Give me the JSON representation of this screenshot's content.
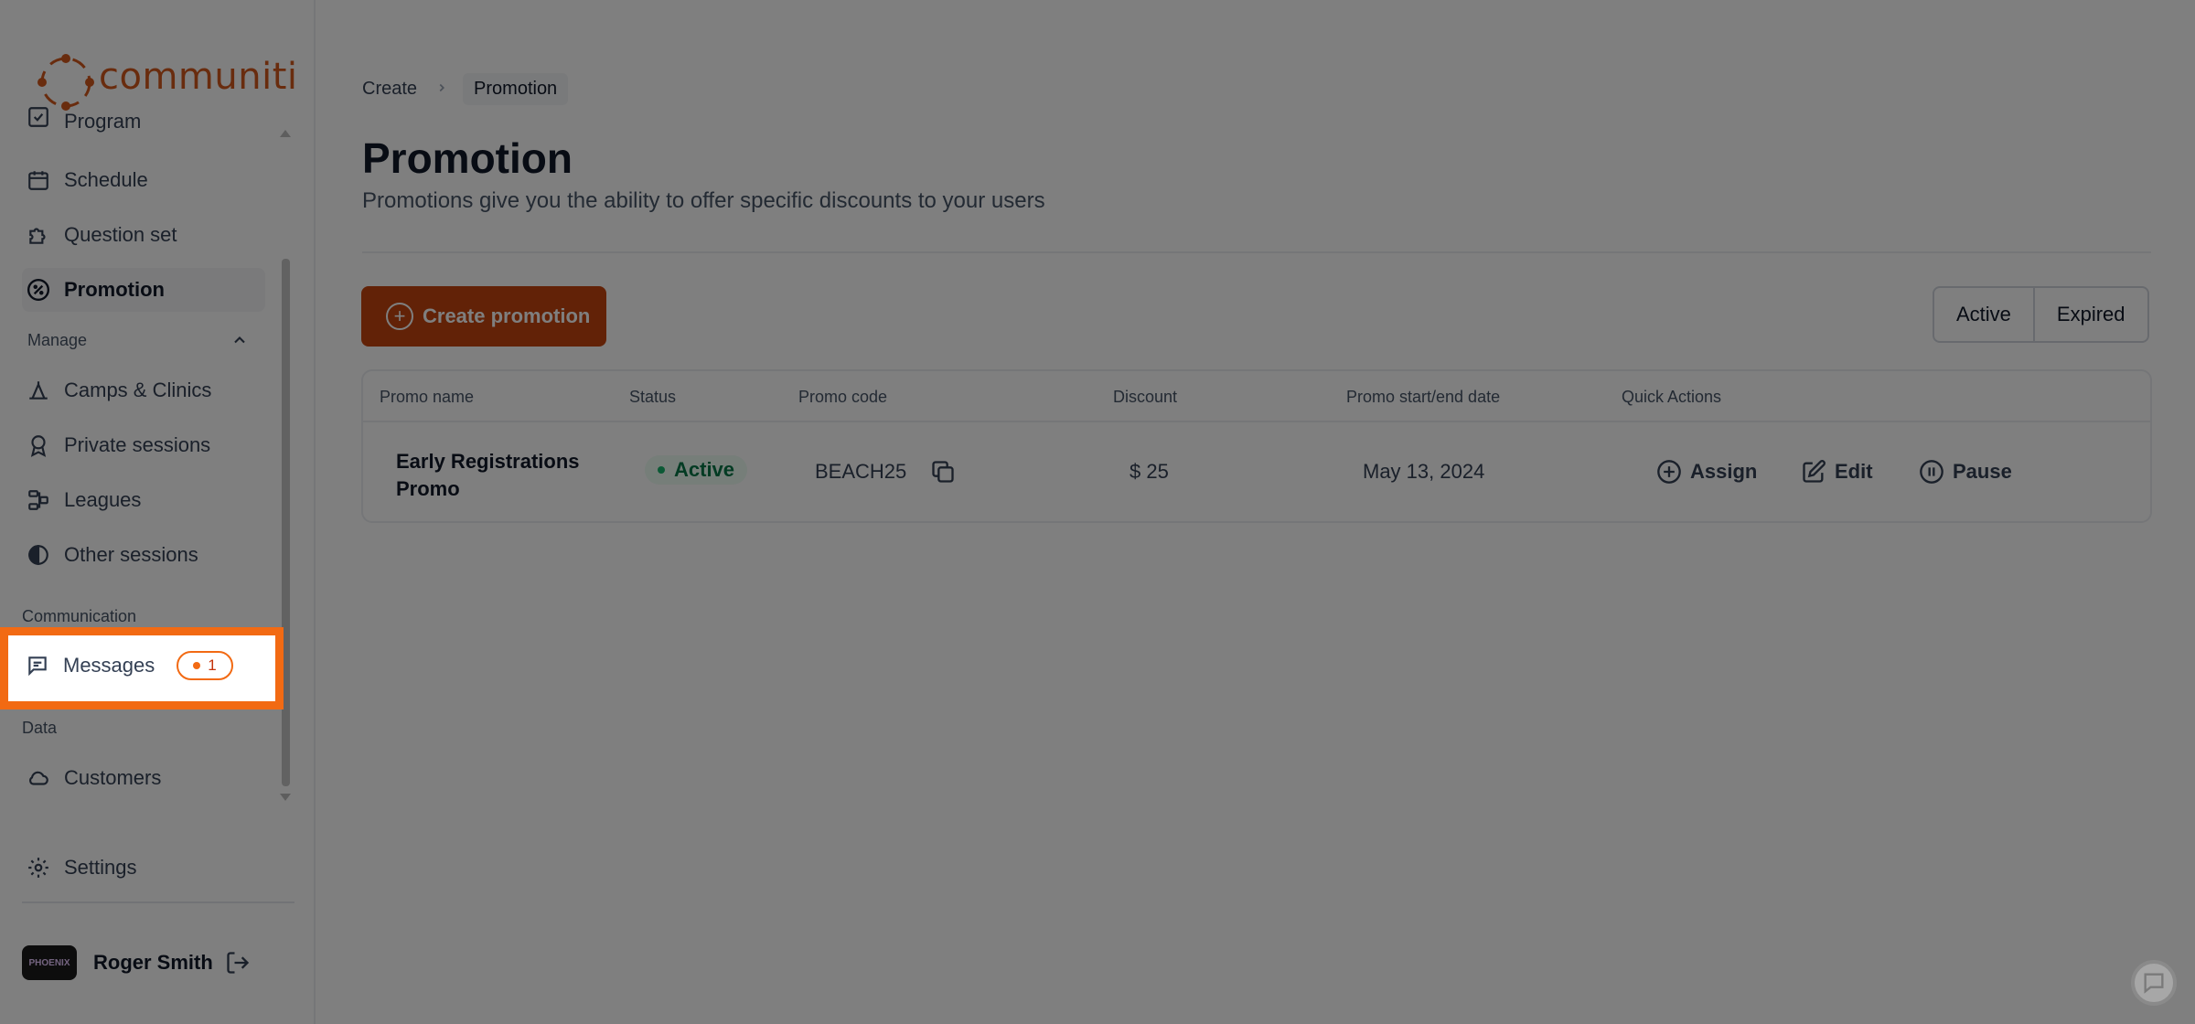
{
  "brand": {
    "name": "communiti",
    "accent": "#d3581d"
  },
  "sidebar": {
    "items": [
      {
        "label": "Program",
        "icon": "program-icon"
      },
      {
        "label": "Schedule",
        "icon": "calendar-icon"
      },
      {
        "label": "Question set",
        "icon": "puzzle-icon"
      },
      {
        "label": "Promotion",
        "icon": "percent-icon",
        "active": true
      }
    ],
    "manage": {
      "label": "Manage",
      "items": [
        {
          "label": "Camps & Clinics",
          "icon": "camp-icon"
        },
        {
          "label": "Private sessions",
          "icon": "award-icon"
        },
        {
          "label": "Leagues",
          "icon": "bracket-icon"
        },
        {
          "label": "Other sessions",
          "icon": "half-circle-icon"
        }
      ]
    },
    "communication": {
      "label": "Communication",
      "messages": {
        "label": "Messages",
        "count": "1"
      }
    },
    "data": {
      "label": "Data",
      "items": [
        {
          "label": "Customers",
          "icon": "cloud-icon"
        }
      ]
    },
    "settings": {
      "label": "Settings"
    },
    "user": {
      "name": "Roger Smith",
      "avatar_text": "PHOENIX"
    }
  },
  "breadcrumb": {
    "root": "Create",
    "current": "Promotion"
  },
  "page": {
    "title": "Promotion",
    "subtitle": "Promotions give you the ability to offer specific discounts to your users"
  },
  "toolbar": {
    "create_label": "Create promotion",
    "filter_active": "Active",
    "filter_expired": "Expired"
  },
  "table": {
    "headers": [
      "Promo name",
      "Status",
      "Promo code",
      "Discount",
      "Promo start/end date",
      "Quick Actions"
    ],
    "rows": [
      {
        "name_line1": "Early Registrations",
        "name_line2": "Promo",
        "status": "Active",
        "code": "BEACH25",
        "discount": "$ 25",
        "date": "May 13, 2024",
        "actions": {
          "assign": "Assign",
          "edit": "Edit",
          "pause": "Pause"
        }
      }
    ]
  }
}
